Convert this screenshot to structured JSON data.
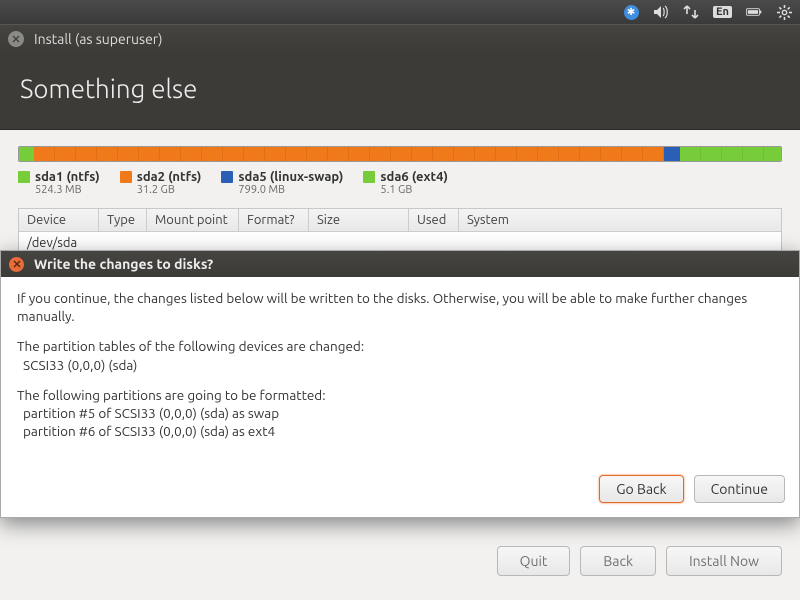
{
  "panel": {
    "lang_indicator": "En"
  },
  "window": {
    "title": "Install (as superuser)"
  },
  "header": {
    "title": "Something else"
  },
  "partitions": {
    "segments": [
      {
        "color": "green",
        "pct": 2.0
      },
      {
        "color": "orange",
        "pct": 82.7
      },
      {
        "color": "blue",
        "pct": 2.1
      },
      {
        "color": "green",
        "pct": 13.2
      }
    ],
    "legend": [
      {
        "swatch": "green",
        "name": "sda1 (ntfs)",
        "size": "524.3 MB"
      },
      {
        "swatch": "orange",
        "name": "sda2 (ntfs)",
        "size": "31.2 GB"
      },
      {
        "swatch": "blue",
        "name": "sda5 (linux-swap)",
        "size": "799.0 MB"
      },
      {
        "swatch": "green",
        "name": "sda6 (ext4)",
        "size": "5.1 GB"
      }
    ]
  },
  "table": {
    "headers": {
      "device": "Device",
      "type": "Type",
      "mount": "Mount point",
      "format": "Format?",
      "size": "Size",
      "used": "Used",
      "system": "System"
    },
    "rows": [
      {
        "device": "/dev/sda"
      }
    ]
  },
  "footer": {
    "quit": "Quit",
    "back": "Back",
    "install": "Install Now"
  },
  "dialog": {
    "title": "Write the changes to disks?",
    "intro": "If you continue, the changes listed below will be written to the disks. Otherwise, you will be able to make further changes manually.",
    "tables_heading": "The partition tables of the following devices are changed:",
    "tables_line1": "SCSI33 (0,0,0) (sda)",
    "format_heading": "The following partitions are going to be formatted:",
    "format_line1": "partition #5 of SCSI33 (0,0,0) (sda) as swap",
    "format_line2": "partition #6 of SCSI33 (0,0,0) (sda) as ext4",
    "go_back": "Go Back",
    "continue": "Continue"
  }
}
